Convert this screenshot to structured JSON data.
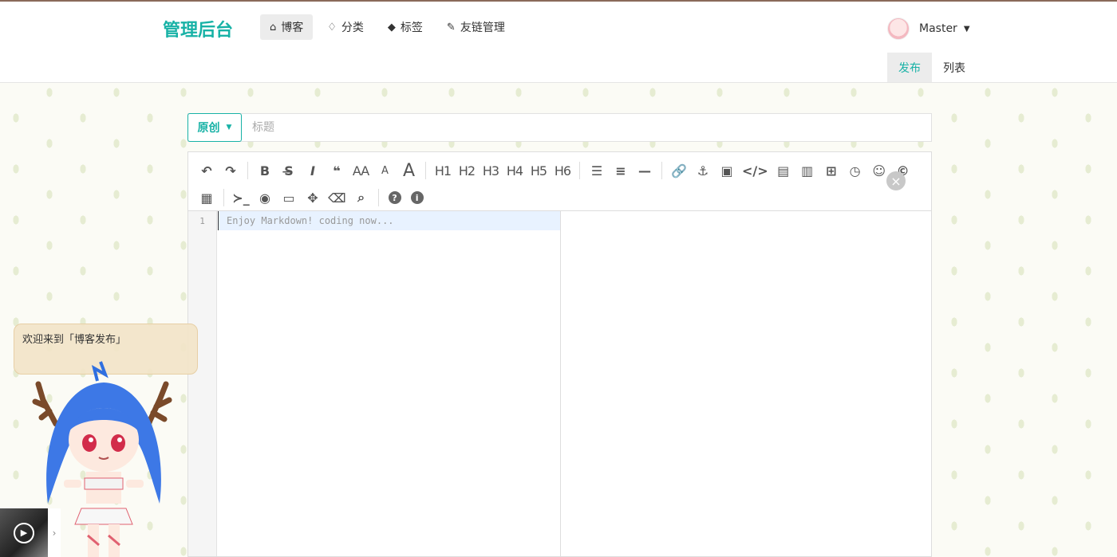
{
  "header": {
    "brand": "管理后台",
    "nav": [
      {
        "icon": "home-icon",
        "glyph": "⌂",
        "label": "博客",
        "active": true
      },
      {
        "icon": "lightbulb-icon",
        "glyph": "♢",
        "label": "分类",
        "active": false
      },
      {
        "icon": "tag-icon",
        "glyph": "◆",
        "label": "标签",
        "active": false
      },
      {
        "icon": "pencil-icon",
        "glyph": "✎",
        "label": "友链管理",
        "active": false
      }
    ],
    "user": {
      "name": "Master"
    }
  },
  "subnav": {
    "publish": "发布",
    "list": "列表"
  },
  "editor": {
    "type_label": "原创",
    "title_placeholder": "标题",
    "line_number": "1",
    "code_placeholder": "Enjoy Markdown! coding now...",
    "close_glyph": "×",
    "toolbar_row1": [
      {
        "name": "undo-icon",
        "glyph": "↶"
      },
      {
        "name": "redo-icon",
        "glyph": "↷"
      },
      {
        "sep": true
      },
      {
        "name": "bold-icon",
        "glyph": "B"
      },
      {
        "name": "strikethrough-icon",
        "glyph": "S̶"
      },
      {
        "name": "italic-icon",
        "glyph": "I"
      },
      {
        "name": "quote-icon",
        "glyph": "❝"
      },
      {
        "name": "uppercase-icon",
        "glyph": "AA"
      },
      {
        "name": "lowercase-icon",
        "glyph": "A"
      },
      {
        "name": "font-size-icon",
        "glyph": "A"
      },
      {
        "sep": true
      },
      {
        "name": "h1-icon",
        "glyph": "H1"
      },
      {
        "name": "h2-icon",
        "glyph": "H2"
      },
      {
        "name": "h3-icon",
        "glyph": "H3"
      },
      {
        "name": "h4-icon",
        "glyph": "H4"
      },
      {
        "name": "h5-icon",
        "glyph": "H5"
      },
      {
        "name": "h6-icon",
        "glyph": "H6"
      },
      {
        "sep": true
      },
      {
        "name": "unordered-list-icon",
        "glyph": "☰"
      },
      {
        "name": "ordered-list-icon",
        "glyph": "≡"
      },
      {
        "name": "horizontal-rule-icon",
        "glyph": "—"
      },
      {
        "sep": true
      },
      {
        "name": "link-icon",
        "glyph": "🔗"
      },
      {
        "name": "anchor-icon",
        "glyph": "⚓"
      },
      {
        "name": "image-icon",
        "glyph": "▣"
      },
      {
        "name": "code-icon",
        "glyph": "</>"
      },
      {
        "name": "code-block-icon",
        "glyph": "▤"
      },
      {
        "name": "file-code-icon",
        "glyph": "▥"
      },
      {
        "name": "table-icon",
        "glyph": "⊞"
      },
      {
        "name": "clock-icon",
        "glyph": "◷"
      },
      {
        "name": "emoji-icon",
        "glyph": "☺"
      },
      {
        "name": "html-entities-icon",
        "glyph": "©"
      }
    ],
    "toolbar_row2": [
      {
        "name": "page-break-icon",
        "glyph": "▦"
      },
      {
        "sep": true
      },
      {
        "name": "terminal-icon",
        "glyph": "≻_"
      },
      {
        "name": "hide-preview-icon",
        "glyph": "◉"
      },
      {
        "name": "desktop-preview-icon",
        "glyph": "▭"
      },
      {
        "name": "fullscreen-icon",
        "glyph": "✥"
      },
      {
        "name": "eraser-icon",
        "glyph": "⌫"
      },
      {
        "name": "search-icon",
        "glyph": "⌕"
      },
      {
        "sep": true
      },
      {
        "name": "help-icon",
        "glyph": "?"
      },
      {
        "name": "info-icon",
        "glyph": "i"
      }
    ]
  },
  "mascot": {
    "bubble_text": "欢迎来到「博客发布」"
  },
  "colors": {
    "accent": "#18b2a6",
    "bubble": "#f2e4c8"
  }
}
